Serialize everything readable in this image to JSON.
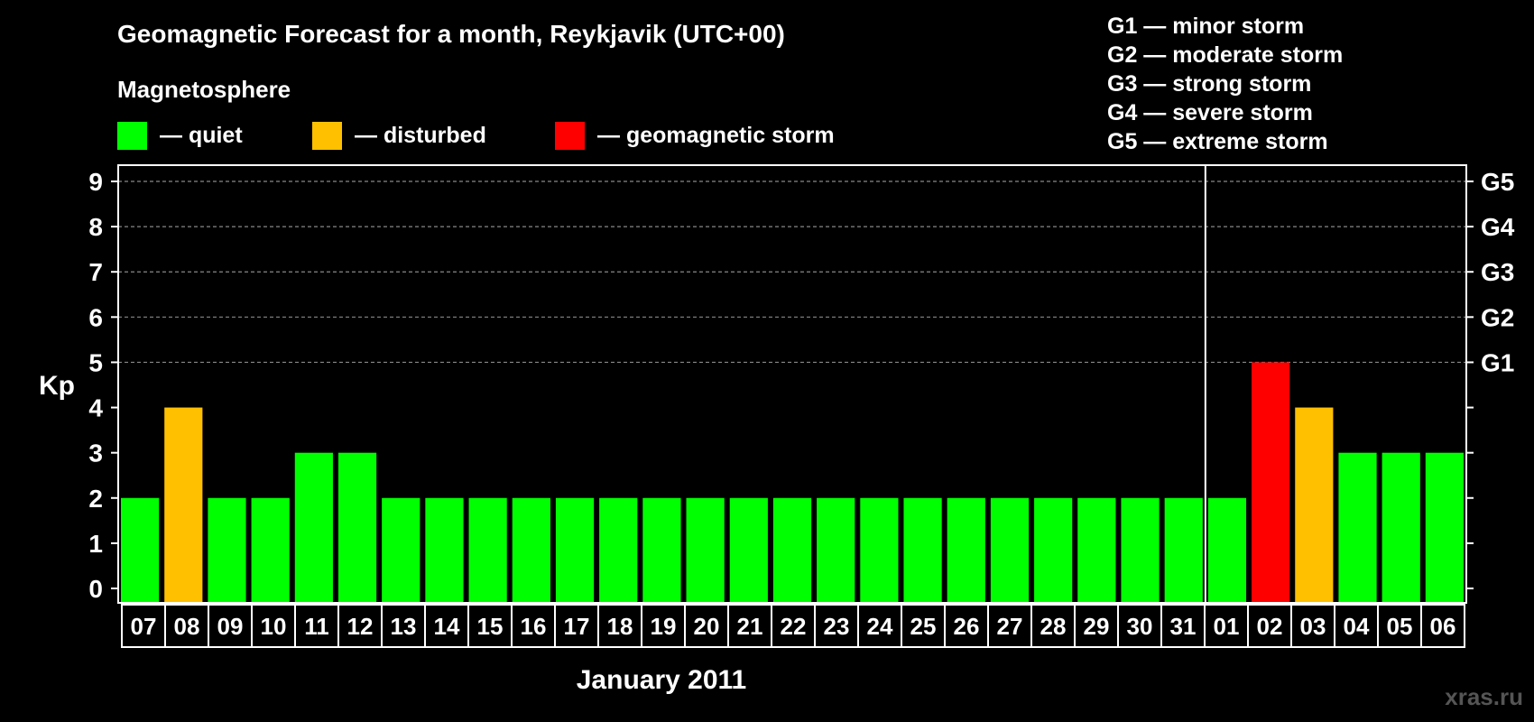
{
  "chart_data": {
    "type": "bar",
    "title": "Geomagnetic Forecast for a month, Reykjavik (UTC+00)",
    "legend_title": "Magnetosphere",
    "legend": [
      {
        "label": "— quiet",
        "color": "#00ff00"
      },
      {
        "label": "— disturbed",
        "color": "#ffc000"
      },
      {
        "label": "— geomagnetic storm",
        "color": "#ff0000"
      }
    ],
    "storm_scale": [
      "G1 — minor storm",
      "G2 — moderate storm",
      "G3 — strong storm",
      "G4 — severe storm",
      "G5 — extreme storm"
    ],
    "ylabel": "Kp",
    "ylim": [
      0,
      9
    ],
    "yticks": [
      "0",
      "1",
      "2",
      "3",
      "4",
      "5",
      "6",
      "7",
      "8",
      "9"
    ],
    "g_levels": [
      {
        "kp": 5,
        "label": "G1"
      },
      {
        "kp": 6,
        "label": "G2"
      },
      {
        "kp": 7,
        "label": "G3"
      },
      {
        "kp": 8,
        "label": "G4"
      },
      {
        "kp": 9,
        "label": "G5"
      }
    ],
    "grid": "dashed horizontal at Kp 5-9",
    "xlabel": "January 2011",
    "month_boundary_after": "31",
    "categories": [
      "07",
      "08",
      "09",
      "10",
      "11",
      "12",
      "13",
      "14",
      "15",
      "16",
      "17",
      "18",
      "19",
      "20",
      "21",
      "22",
      "23",
      "24",
      "25",
      "26",
      "27",
      "28",
      "29",
      "30",
      "31",
      "01",
      "02",
      "03",
      "04",
      "05",
      "06"
    ],
    "values": [
      2,
      4,
      2,
      2,
      3,
      3,
      2,
      2,
      2,
      2,
      2,
      2,
      2,
      2,
      2,
      2,
      2,
      2,
      2,
      2,
      2,
      2,
      2,
      2,
      2,
      2,
      5,
      4,
      3,
      3,
      3
    ],
    "colors": {
      "quiet": "#00ff00",
      "disturbed": "#ffc000",
      "storm": "#ff0000"
    }
  },
  "watermark": "xras.ru"
}
